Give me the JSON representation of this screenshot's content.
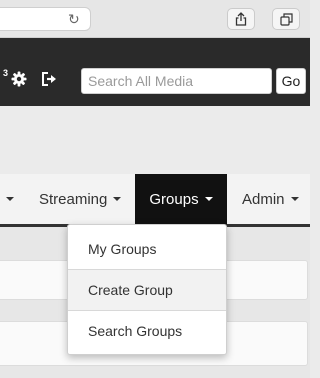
{
  "search": {
    "placeholder": "Search All Media",
    "value": "",
    "go_label": "Go"
  },
  "header": {
    "notification_count": "3"
  },
  "nav": {
    "items": [
      {
        "label": "Streaming"
      },
      {
        "label": "Groups"
      },
      {
        "label": "Admin"
      }
    ]
  },
  "dropdown": {
    "items": [
      {
        "label": "My Groups"
      },
      {
        "label": "Create Group"
      },
      {
        "label": "Search Groups"
      }
    ]
  }
}
